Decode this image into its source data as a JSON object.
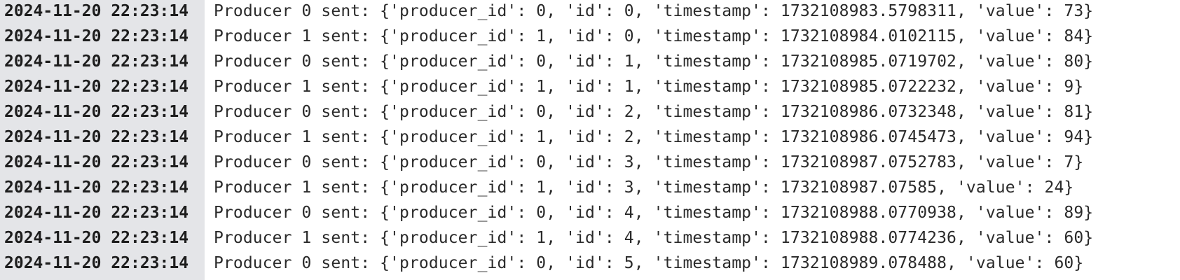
{
  "log": {
    "lines": [
      {
        "timestamp": "2024-11-20 22:23:14",
        "message": "Producer 0 sent: {'producer_id': 0, 'id': 0, 'timestamp': 1732108983.5798311, 'value': 73}"
      },
      {
        "timestamp": "2024-11-20 22:23:14",
        "message": "Producer 1 sent: {'producer_id': 1, 'id': 0, 'timestamp': 1732108984.0102115, 'value': 84}"
      },
      {
        "timestamp": "2024-11-20 22:23:14",
        "message": "Producer 0 sent: {'producer_id': 0, 'id': 1, 'timestamp': 1732108985.0719702, 'value': 80}"
      },
      {
        "timestamp": "2024-11-20 22:23:14",
        "message": "Producer 1 sent: {'producer_id': 1, 'id': 1, 'timestamp': 1732108985.0722232, 'value': 9}"
      },
      {
        "timestamp": "2024-11-20 22:23:14",
        "message": "Producer 0 sent: {'producer_id': 0, 'id': 2, 'timestamp': 1732108986.0732348, 'value': 81}"
      },
      {
        "timestamp": "2024-11-20 22:23:14",
        "message": "Producer 1 sent: {'producer_id': 1, 'id': 2, 'timestamp': 1732108986.0745473, 'value': 94}"
      },
      {
        "timestamp": "2024-11-20 22:23:14",
        "message": "Producer 0 sent: {'producer_id': 0, 'id': 3, 'timestamp': 1732108987.0752783, 'value': 7}"
      },
      {
        "timestamp": "2024-11-20 22:23:14",
        "message": "Producer 1 sent: {'producer_id': 1, 'id': 3, 'timestamp': 1732108987.07585, 'value': 24}"
      },
      {
        "timestamp": "2024-11-20 22:23:14",
        "message": "Producer 0 sent: {'producer_id': 0, 'id': 4, 'timestamp': 1732108988.0770938, 'value': 89}"
      },
      {
        "timestamp": "2024-11-20 22:23:14",
        "message": "Producer 1 sent: {'producer_id': 1, 'id': 4, 'timestamp': 1732108988.0774236, 'value': 60}"
      },
      {
        "timestamp": "2024-11-20 22:23:14",
        "message": "Producer 0 sent: {'producer_id': 0, 'id': 5, 'timestamp': 1732108989.078488, 'value': 60}"
      }
    ]
  },
  "colors": {
    "gutter_background": "#e4e5e8",
    "text": "#2a2a2a",
    "background": "#ffffff"
  }
}
